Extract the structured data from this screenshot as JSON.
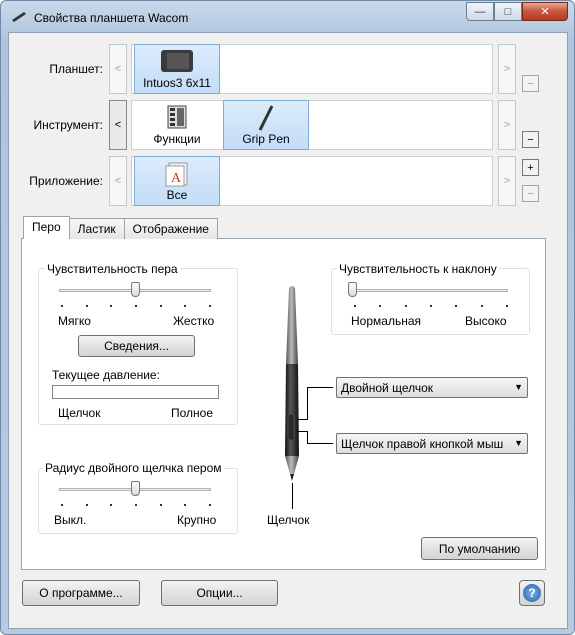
{
  "window": {
    "title": "Свойства планшета Wacom",
    "controls": [
      "—",
      "□",
      "✕"
    ]
  },
  "rows": {
    "tablet": {
      "label": "Планшет:",
      "items": [
        "Intuos3 6x11"
      ]
    },
    "tool": {
      "label": "Инструмент:",
      "items": [
        "Функции",
        "Grip Pen"
      ]
    },
    "app": {
      "label": "Приложение:",
      "items": [
        "Все"
      ]
    }
  },
  "tabs": [
    "Перо",
    "Ластик",
    "Отображение"
  ],
  "pen": {
    "sensitivity": {
      "title": "Чувствительность пера",
      "left": "Мягко",
      "right": "Жестко",
      "details": "Сведения...",
      "value": 0.5
    },
    "pressure": {
      "title": "Текущее давление:",
      "left": "Щелчок",
      "right": "Полное"
    },
    "tilt": {
      "title": "Чувствительность к наклону",
      "left": "Нормальная",
      "right": "Высоко",
      "value": 0.0
    },
    "double_click": {
      "title": "Радиус двойного щелчка пером",
      "left": "Выкл.",
      "right": "Крупно",
      "value": 0.5
    },
    "upper_button": "Двойной щелчок",
    "lower_button": "Щелчок правой кнопкой мыш",
    "tip": "Щелчок",
    "defaults": "По умолчанию"
  },
  "footer": {
    "about": "О программе...",
    "options": "Опции...",
    "help": "?"
  }
}
